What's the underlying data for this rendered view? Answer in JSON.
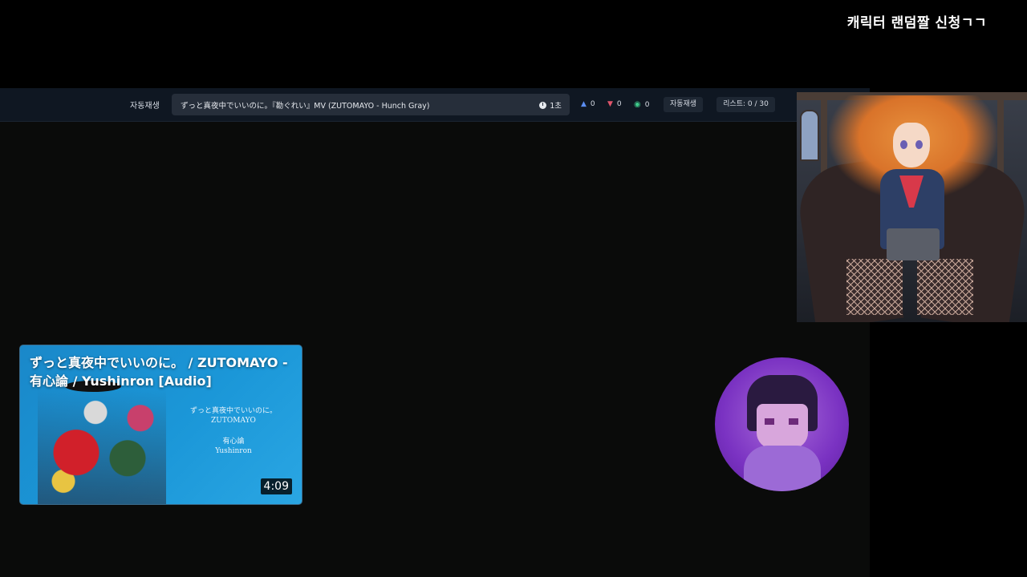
{
  "overlay": {
    "title": "캐릭터 랜덤짤 신청ㄱㄱ"
  },
  "toolbar": {
    "autoplay_label": "자동재생",
    "now_playing": "ずっと真夜中でいいのに。『勘ぐれい』MV (ZUTOMAYO - Hunch Gray)",
    "time_remaining": "1초",
    "likes": "0",
    "dislikes": "0",
    "views": "0",
    "autoplay_button": "자동재생",
    "list_count": "리스트: 0 / 30"
  },
  "icons": {
    "like": "thumbs-up-icon",
    "dislike": "thumbs-down-icon",
    "views": "eye-icon",
    "clock": "clock-icon"
  },
  "video_card": {
    "title": "ずっと真夜中でいいのに。 / ZUTOMAYO - 有心論 / Yushinron [Audio]",
    "cover_line1": "ずっと真夜中でいいのに。",
    "cover_line2": "ZUTOMAYO",
    "cover_line3": "有心論",
    "cover_line4": "Yushinron",
    "duration": "4:09"
  },
  "colors": {
    "toolbar_bg": "#0f1722",
    "like": "#5b8df0",
    "dislike": "#e0556b",
    "views": "#3ec98a",
    "card_bg": "#1b97d8",
    "avatar_bg": "#7a32c2"
  }
}
